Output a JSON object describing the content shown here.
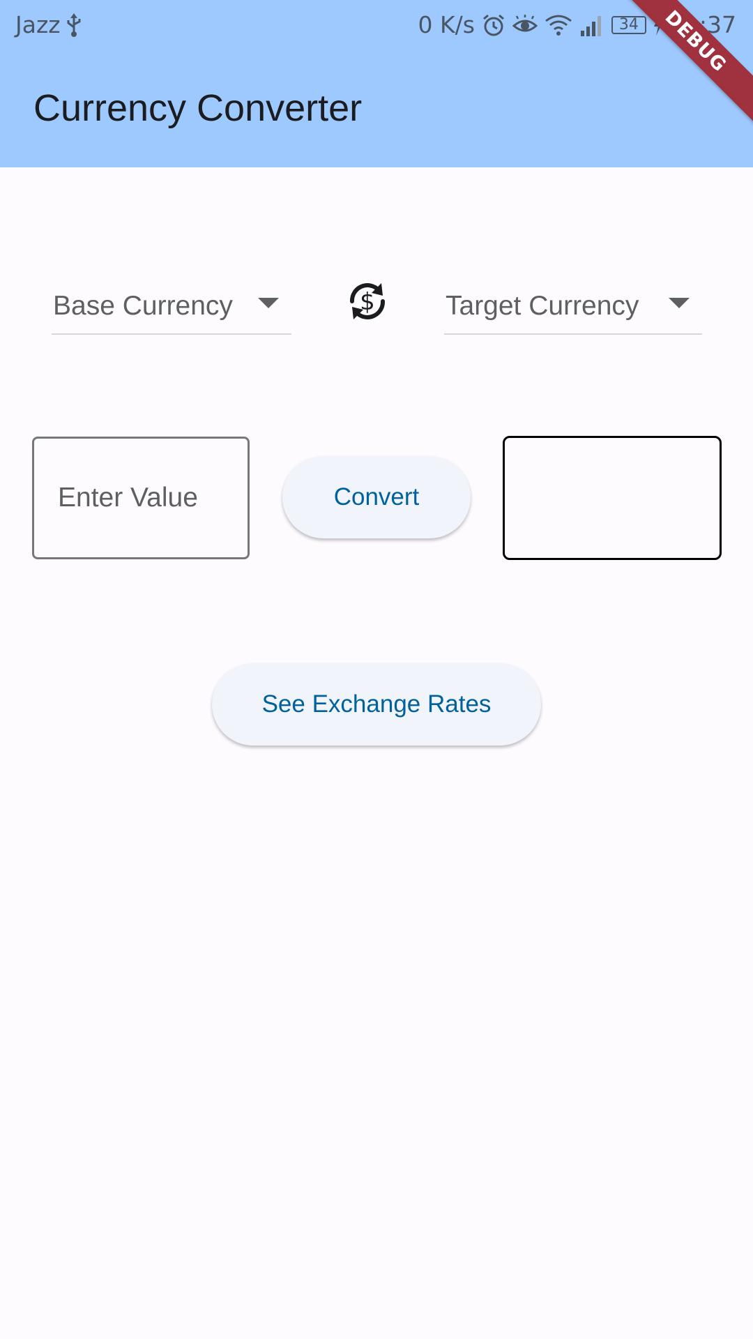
{
  "status_bar": {
    "carrier": "Jazz",
    "net_speed": "0 K/s",
    "battery_level": "34",
    "time": "11:37",
    "icons": [
      "usb-icon",
      "alarm-icon",
      "eye-icon",
      "wifi-icon",
      "signal-icon",
      "battery-icon",
      "charging-icon"
    ]
  },
  "app_bar": {
    "title": "Currency Converter",
    "background_color": "#9ec9ff"
  },
  "debug_banner": {
    "label": "DEBUG",
    "color": "#a0323f"
  },
  "selectors": {
    "base_label": "Base Currency",
    "target_label": "Target Currency",
    "swap_icon": "currency-exchange-icon"
  },
  "conversion": {
    "input_placeholder": "Enter Value",
    "input_value": "",
    "convert_label": "Convert",
    "result_value": ""
  },
  "actions": {
    "see_rates_label": "See Exchange Rates"
  },
  "colors": {
    "accent": "#00629c",
    "button_bg": "#f1f4fa",
    "page_bg": "#fefbff"
  }
}
